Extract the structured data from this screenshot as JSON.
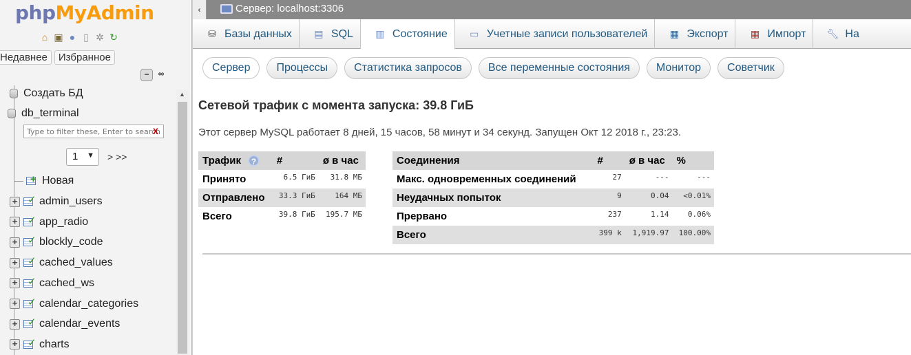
{
  "logo": {
    "php": "php",
    "myadmin": "MyAdmin"
  },
  "nav_icons": [
    "home-icon",
    "exit-icon",
    "help-icon",
    "docs-icon",
    "settings-icon",
    "reload-icon"
  ],
  "nav_tabs": {
    "recent": "Недавнее",
    "favorites": "Избранное"
  },
  "tree": {
    "create_db": "Создать БД",
    "db_name": "db_terminal",
    "filter_placeholder": "Type to filter these, Enter to search",
    "filter_clear": "X",
    "page_value": "1",
    "page_next": "> >>",
    "new_table": "Новая",
    "tables": [
      "admin_users",
      "app_radio",
      "blockly_code",
      "cached_values",
      "cached_ws",
      "calendar_categories",
      "calendar_events",
      "charts"
    ]
  },
  "topbar": {
    "back": "‹",
    "server": "Сервер: localhost:3306"
  },
  "tabs": [
    {
      "label": "Базы данных",
      "icon": "database-icon"
    },
    {
      "label": "SQL",
      "icon": "sql-icon"
    },
    {
      "label": "Состояние",
      "icon": "status-icon"
    },
    {
      "label": "Учетные записи пользователей",
      "icon": "users-icon"
    },
    {
      "label": "Экспорт",
      "icon": "export-icon"
    },
    {
      "label": "Импорт",
      "icon": "import-icon"
    },
    {
      "label": "На",
      "icon": "wrench-icon"
    }
  ],
  "subtabs": [
    "Сервер",
    "Процессы",
    "Статистика запросов",
    "Все переменные состояния",
    "Монитор",
    "Советчик"
  ],
  "heading": "Сетевой трафик с момента запуска: 39.8 ГиБ",
  "uptime": "Этот сервер MySQL работает 8 дней, 15 часов, 58 минут и 34 секунд. Запущен Окт 12 2018 г., 23:23.",
  "traffic": {
    "headers": [
      "Трафик",
      "#",
      "ø в час"
    ],
    "rows": [
      [
        "Принято",
        "6.5 ГиБ",
        "31.8 МБ"
      ],
      [
        "Отправлено",
        "33.3 ГиБ",
        "164 МБ"
      ],
      [
        "Всего",
        "39.8 ГиБ",
        "195.7 МБ"
      ]
    ]
  },
  "connections": {
    "headers": [
      "Соединения",
      "#",
      "ø в час",
      "%"
    ],
    "rows": [
      [
        "Макс. одновременных соединений",
        "27",
        "---",
        "---"
      ],
      [
        "Неудачных попыток",
        "9",
        "0.04",
        "<0.01%"
      ],
      [
        "Прервано",
        "237",
        "1.14",
        "0.06%"
      ],
      [
        "Всего",
        "399 k",
        "1,919.97",
        "100.00%"
      ]
    ]
  }
}
